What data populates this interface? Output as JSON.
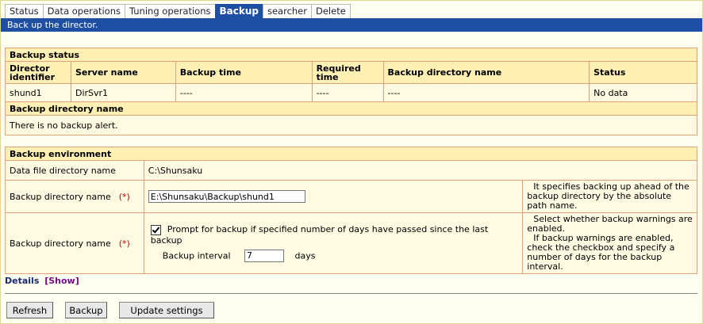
{
  "tabs": [
    {
      "label": "Status",
      "active": false
    },
    {
      "label": "Data operations",
      "active": false
    },
    {
      "label": "Tuning operations",
      "active": false
    },
    {
      "label": "Backup",
      "active": true
    },
    {
      "label": "searcher",
      "active": false
    },
    {
      "label": "Delete",
      "active": false
    }
  ],
  "subtitle": "Back up the director.",
  "backup_status": {
    "title": "Backup status",
    "columns": [
      "Director identifier",
      "Server name",
      "Backup time",
      "Required time",
      "Backup directory name",
      "Status"
    ],
    "row": [
      "shund1",
      "DirSvr1",
      "----",
      "----",
      "----",
      "No data"
    ]
  },
  "backup_dir_section": {
    "title": "Backup directory name",
    "message": "There is no backup alert."
  },
  "environment": {
    "title": "Backup environment",
    "data_file_label": "Data file directory name",
    "data_file_value": "C:\\Shunsaku",
    "backup_dir_label": "Backup directory name",
    "required_mark": "(*)",
    "backup_dir_value": "E:\\Shunsaku\\Backup\\shund1",
    "backup_dir_help": "It specifies backing up ahead of the backup directory by the absolute path name.",
    "warning_label": "Backup directory name",
    "prompt_text": "Prompt for backup if specified number of days have passed since the last backup",
    "prompt_checked": true,
    "interval_label": "Backup interval",
    "interval_value": "7",
    "interval_unit": "days",
    "warning_help_1": "Select whether backup warnings are enabled.",
    "warning_help_2": "If backup warnings are enabled, check the checkbox and specify a number of days for the backup interval."
  },
  "details": {
    "label": "Details",
    "show": "[Show]"
  },
  "buttons": {
    "refresh": "Refresh",
    "backup": "Backup",
    "update": "Update settings"
  }
}
